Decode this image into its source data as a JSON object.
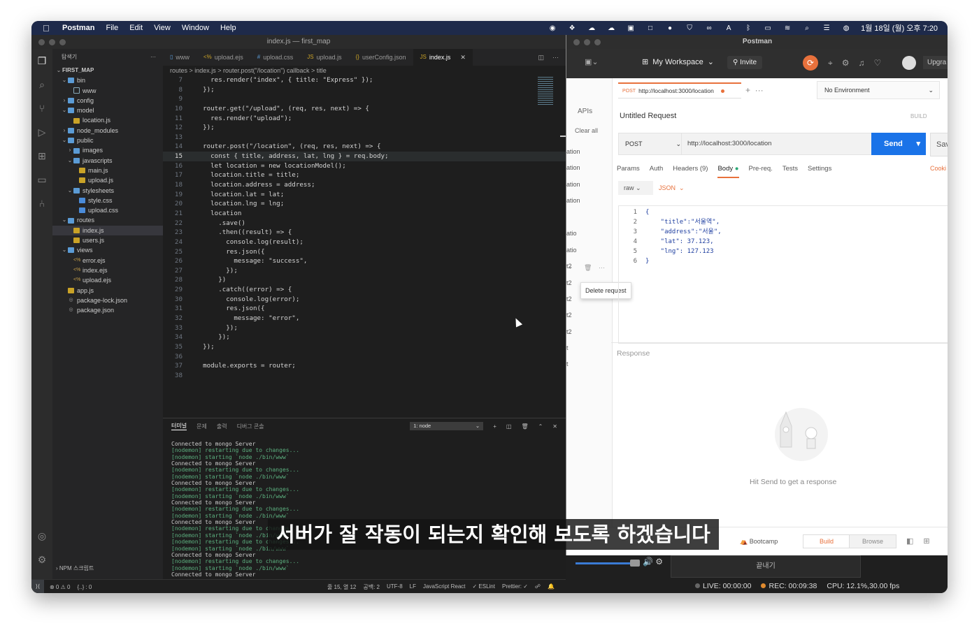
{
  "menubar": {
    "app": "Postman",
    "items": [
      "File",
      "Edit",
      "View",
      "Window",
      "Help"
    ],
    "clock": "1월 18일 (월) 오후 7:20"
  },
  "vscode": {
    "title": "index.js — first_map",
    "explorer_label": "탐색기",
    "tree": [
      {
        "label": "FIRST_MAP",
        "depth": 0,
        "type": "root"
      },
      {
        "label": "bin",
        "depth": 1,
        "type": "folder"
      },
      {
        "label": "www",
        "depth": 2,
        "type": "www"
      },
      {
        "label": "config",
        "depth": 1,
        "type": "folder-closed"
      },
      {
        "label": "model",
        "depth": 1,
        "type": "folder"
      },
      {
        "label": "location.js",
        "depth": 2,
        "type": "js"
      },
      {
        "label": "node_modules",
        "depth": 1,
        "type": "folder-closed"
      },
      {
        "label": "public",
        "depth": 1,
        "type": "folder"
      },
      {
        "label": "images",
        "depth": 2,
        "type": "folder-closed"
      },
      {
        "label": "javascripts",
        "depth": 2,
        "type": "folder"
      },
      {
        "label": "main.js",
        "depth": 3,
        "type": "js"
      },
      {
        "label": "upload.js",
        "depth": 3,
        "type": "js"
      },
      {
        "label": "stylesheets",
        "depth": 2,
        "type": "folder"
      },
      {
        "label": "style.css",
        "depth": 3,
        "type": "css"
      },
      {
        "label": "upload.css",
        "depth": 3,
        "type": "css"
      },
      {
        "label": "routes",
        "depth": 1,
        "type": "folder"
      },
      {
        "label": "index.js",
        "depth": 2,
        "type": "js",
        "selected": true
      },
      {
        "label": "users.js",
        "depth": 2,
        "type": "js"
      },
      {
        "label": "views",
        "depth": 1,
        "type": "folder"
      },
      {
        "label": "error.ejs",
        "depth": 2,
        "type": "ejs"
      },
      {
        "label": "index.ejs",
        "depth": 2,
        "type": "ejs"
      },
      {
        "label": "upload.ejs",
        "depth": 2,
        "type": "ejs"
      },
      {
        "label": "app.js",
        "depth": 1,
        "type": "js"
      },
      {
        "label": "package-lock.json",
        "depth": 1,
        "type": "json"
      },
      {
        "label": "package.json",
        "depth": 1,
        "type": "json"
      }
    ],
    "npm_scripts": "NPM 스크립트",
    "tabs": [
      {
        "label": "www",
        "icon": "file-icon"
      },
      {
        "label": "upload.ejs",
        "icon": "ejs-icon"
      },
      {
        "label": "upload.css",
        "icon": "css-icon"
      },
      {
        "label": "upload.js",
        "icon": "js-icon"
      },
      {
        "label": "userConfig.json",
        "icon": "json-icon"
      },
      {
        "label": "index.js",
        "icon": "js-icon",
        "active": true
      }
    ],
    "breadcrumb": "routes > index.js > router.post(\"/location\") callback > title",
    "current_line": 15,
    "code": [
      {
        "n": "7",
        "t": "    res.render(\"index\", { title: \"Express\" });"
      },
      {
        "n": "8",
        "t": "  });"
      },
      {
        "n": "9",
        "t": ""
      },
      {
        "n": "10",
        "t": "  router.get(\"/upload\", (req, res, next) => {"
      },
      {
        "n": "11",
        "t": "    res.render(\"upload\");"
      },
      {
        "n": "12",
        "t": "  });"
      },
      {
        "n": "13",
        "t": ""
      },
      {
        "n": "14",
        "t": "  router.post(\"/location\", (req, res, next) => {"
      },
      {
        "n": "15",
        "t": "    const { title, address, lat, lng } = req.body;"
      },
      {
        "n": "16",
        "t": "    let location = new locationModel();"
      },
      {
        "n": "17",
        "t": "    location.title = title;"
      },
      {
        "n": "18",
        "t": "    location.address = address;"
      },
      {
        "n": "19",
        "t": "    location.lat = lat;"
      },
      {
        "n": "20",
        "t": "    location.lng = lng;"
      },
      {
        "n": "21",
        "t": "    location"
      },
      {
        "n": "22",
        "t": "      .save()"
      },
      {
        "n": "23",
        "t": "      .then((result) => {"
      },
      {
        "n": "24",
        "t": "        console.log(result);"
      },
      {
        "n": "25",
        "t": "        res.json({"
      },
      {
        "n": "26",
        "t": "          message: \"success\","
      },
      {
        "n": "27",
        "t": "        });"
      },
      {
        "n": "28",
        "t": "      })"
      },
      {
        "n": "29",
        "t": "      .catch((error) => {"
      },
      {
        "n": "30",
        "t": "        console.log(error);"
      },
      {
        "n": "31",
        "t": "        res.json({"
      },
      {
        "n": "32",
        "t": "          message: \"error\","
      },
      {
        "n": "33",
        "t": "        });"
      },
      {
        "n": "34",
        "t": "      });"
      },
      {
        "n": "35",
        "t": "  });"
      },
      {
        "n": "36",
        "t": ""
      },
      {
        "n": "37",
        "t": "  module.exports = router;"
      },
      {
        "n": "38",
        "t": ""
      }
    ],
    "panel_tabs": [
      "터미널",
      "문제",
      "출력",
      "디버그 콘솔"
    ],
    "terminal_select": "1: node",
    "terminal": [
      {
        "k": "plain",
        "t": "Connected to mongo Server"
      },
      {
        "k": "node",
        "t": "[nodemon] restarting due to changes..."
      },
      {
        "k": "node",
        "t": "[nodemon] starting `node ./bin/www`"
      },
      {
        "k": "plain",
        "t": "Connected to mongo Server"
      },
      {
        "k": "node",
        "t": "[nodemon] restarting due to changes..."
      },
      {
        "k": "node",
        "t": "[nodemon] starting `node ./bin/www`"
      },
      {
        "k": "plain",
        "t": "Connected to mongo Server"
      },
      {
        "k": "node",
        "t": "[nodemon] restarting due to changes..."
      },
      {
        "k": "node",
        "t": "[nodemon] starting `node ./bin/www`"
      },
      {
        "k": "plain",
        "t": "Connected to mongo Server"
      },
      {
        "k": "node",
        "t": "[nodemon] restarting due to changes..."
      },
      {
        "k": "node",
        "t": "[nodemon] starting `node ./bin/www`"
      },
      {
        "k": "plain",
        "t": "Connected to mongo Server"
      },
      {
        "k": "node",
        "t": "[nodemon] restarting due to changes..."
      },
      {
        "k": "node",
        "t": "[nodemon] starting `node ./bin/www`"
      },
      {
        "k": "node",
        "t": "[nodemon] restarting due to changes..."
      },
      {
        "k": "node",
        "t": "[nodemon] starting `node ./bin/www`"
      },
      {
        "k": "plain",
        "t": "Connected to mongo Server"
      },
      {
        "k": "node",
        "t": "[nodemon] restarting due to changes..."
      },
      {
        "k": "node",
        "t": "[nodemon] starting `node ./bin/www`"
      },
      {
        "k": "plain",
        "t": "Connected to mongo Server"
      },
      {
        "k": "plain",
        "t": "▯"
      }
    ],
    "status": {
      "errors": "⊗ 0 ⚠ 0",
      "braces": "{..} : 0",
      "position": "줄 15, 열 12",
      "spaces": "공백: 2",
      "encoding": "UTF-8",
      "eol": "LF",
      "language": "JavaScript React",
      "eslint": "✓ ESLint",
      "prettier": "Prettier: ✓"
    }
  },
  "postman": {
    "title": "Postman",
    "workspace": "My Workspace",
    "invite": "Invite",
    "upgrade": "Upgra",
    "apis": "APIs",
    "clear_all": "Clear all",
    "history_items": [
      "ation",
      "ation",
      "ation",
      "ation",
      "atio",
      "atio",
      "t2",
      "t2",
      "t2",
      "t2",
      "t2",
      "t",
      "t"
    ],
    "tooltip": "Delete request",
    "request_tab": {
      "method": "POST",
      "url": "http://localhost:3000/location"
    },
    "environment": "No Environment",
    "request_title": "Untitled Request",
    "build_label": "BUILD",
    "method": "POST",
    "url": "http://localhost:3000/location",
    "send": "Send",
    "save": "Sav",
    "tabs": [
      "Params",
      "Auth",
      "Headers (9)",
      "Body",
      "Pre-req.",
      "Tests",
      "Settings"
    ],
    "cookies": "Cooki",
    "body_mode": "raw",
    "body_format": "JSON",
    "body_lines": [
      {
        "n": "1",
        "t": "{"
      },
      {
        "n": "2",
        "t": "    \"title\":\"서울역\","
      },
      {
        "n": "3",
        "t": "    \"address\":\"서울\","
      },
      {
        "n": "4",
        "t": "    \"lat\": 37.123,"
      },
      {
        "n": "5",
        "t": "    \"lng\": 127.123"
      },
      {
        "n": "6",
        "t": "}"
      }
    ],
    "response_label": "Response",
    "empty_response": "Hit Send to get a response",
    "bottom": {
      "bootcamp": "Bootcamp",
      "build": "Build",
      "browse": "Browse"
    }
  },
  "obs": {
    "quit": "끝내기",
    "live": "LIVE: 00:00:00",
    "rec": "REC: 00:09:38",
    "cpu": "CPU: 12.1%,30.00 fps"
  },
  "subtitle": "서버가 잘 작동이 되는지 확인해 보도록 하겠습니다",
  "colors": {
    "postman_orange": "#e8713c",
    "send_blue": "#1a73e8",
    "terminal_green": "#5cb07f"
  }
}
